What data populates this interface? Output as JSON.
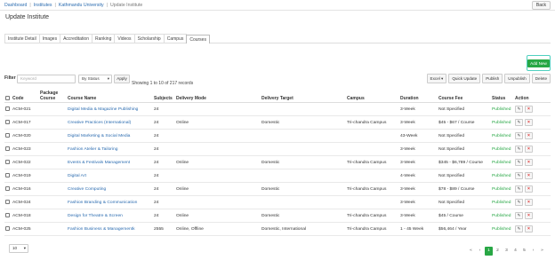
{
  "breadcrumb": [
    "Dashboard",
    "Institutes",
    "Kathmandu University",
    "Update Institute"
  ],
  "back_label": "Back",
  "page_title": "Update Institute",
  "tabs": [
    "Institute Detail",
    "Images",
    "Accreditation",
    "Ranking",
    "Videos",
    "Scholarship",
    "Campus",
    "Courses"
  ],
  "active_tab": "Courses",
  "add_new": "Add New",
  "filter": {
    "label": "Filter",
    "keyword_placeholder": "Keyword",
    "status_select": "By Status",
    "apply": "Apply",
    "showing": "Showing 1 to 10 of 217 records"
  },
  "bulk_actions": [
    "Excel",
    "Quick Update",
    "Publish",
    "Unpublish",
    "Delete"
  ],
  "columns": {
    "code": "Code",
    "package": "Package Course",
    "name": "Course Name",
    "subjects": "Subjects",
    "mode": "Delivery Mode",
    "target": "Delivery Target",
    "campus": "Campus",
    "duration": "Duration",
    "fee": "Course Fee",
    "status": "Status",
    "action": "Action"
  },
  "rows": [
    {
      "code": "ACM-021",
      "package": "",
      "name": "Digital Media & Magazine Publishing",
      "subjects": "24",
      "mode": "",
      "target": "",
      "campus": "",
      "duration": "3-Week",
      "fee": "Not Specified",
      "status": "Published"
    },
    {
      "code": "ACM-017",
      "package": "",
      "name": "Creative Practices (International)",
      "subjects": "24",
      "mode": "Online",
      "target": "Domestic",
      "campus": "Tri-chandra Campus",
      "duration": "3-Week",
      "fee": "$45 - $67 / Course",
      "status": "Published"
    },
    {
      "code": "ACM-020",
      "package": "",
      "name": "Digital Marketing & Social Media",
      "subjects": "24",
      "mode": "",
      "target": "",
      "campus": "",
      "duration": "43-Week",
      "fee": "Not Specified",
      "status": "Published"
    },
    {
      "code": "ACM-023",
      "package": "",
      "name": "Fashion Atelier & Tailoring",
      "subjects": "24",
      "mode": "",
      "target": "",
      "campus": "",
      "duration": "3-Week",
      "fee": "Not Specified",
      "status": "Published"
    },
    {
      "code": "ACM-022",
      "package": "",
      "name": "Events & Festivals Management",
      "subjects": "24",
      "mode": "Online",
      "target": "Domestic",
      "campus": "Tri-chandra Campus",
      "duration": "3-Week",
      "fee": "$345 - $6,789 / Course",
      "status": "Published"
    },
    {
      "code": "ACM-019",
      "package": "",
      "name": "Digital Art",
      "subjects": "24",
      "mode": "",
      "target": "",
      "campus": "",
      "duration": "4-Week",
      "fee": "Not Specified",
      "status": "Published"
    },
    {
      "code": "ACM-016",
      "package": "",
      "name": "Creative Computing",
      "subjects": "24",
      "mode": "Online",
      "target": "Domestic",
      "campus": "Tri-chandra Campus",
      "duration": "3-Week",
      "fee": "$78 - $89 / Course",
      "status": "Published"
    },
    {
      "code": "ACM-024",
      "package": "",
      "name": "Fashion Branding & Communication",
      "subjects": "24",
      "mode": "",
      "target": "",
      "campus": "",
      "duration": "3-Week",
      "fee": "Not Specified",
      "status": "Published"
    },
    {
      "code": "ACM-018",
      "package": "",
      "name": "Design for Theatre & Screen",
      "subjects": "24",
      "mode": "Online",
      "target": "Domestic",
      "campus": "Tri-chandra Campus",
      "duration": "3-Week",
      "fee": "$45 / Course",
      "status": "Published"
    },
    {
      "code": "ACM-025",
      "package": "",
      "name": "Fashion Business & Managementk",
      "subjects": "2555",
      "mode": "Online, Offline",
      "target": "Domestic, International",
      "campus": "Tri-chandra Campus",
      "duration": "1 - 45 Week",
      "fee": "$56,464 / Year",
      "status": "Published"
    }
  ],
  "icons": {
    "edit": "pencil-icon",
    "delete": "x-icon",
    "check": "checkbox-icon"
  },
  "colors": {
    "link": "#2b6cb0",
    "published": "#28a745",
    "delete": "#dd3333",
    "add_border": "#50d0c0"
  },
  "per_page": "10",
  "pagination": [
    "«",
    "‹",
    "1",
    "2",
    "3",
    "4",
    "5",
    "›",
    "»"
  ],
  "current_page": "1"
}
